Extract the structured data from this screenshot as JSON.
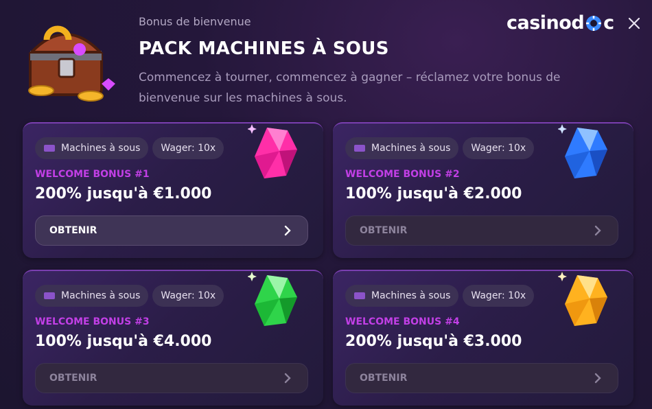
{
  "header": {
    "subtitle": "Bonus de bienvenue",
    "title": "PACK MACHINES À SOUS",
    "description": "Commencez à tourner, commencez à gagner – réclamez votre bonus de bienvenue sur les machines à sous.",
    "logo_left": "casinod",
    "logo_right": "c",
    "chest_icon": "treasure-chest-icon",
    "close_icon": "close-icon"
  },
  "cards": [
    {
      "tag_category": "Machines à sous",
      "tag_wager": "Wager: 10x",
      "bonus_label": "WELCOME BONUS #1",
      "amount": "200% jusqu'à €1.000",
      "button": "OBTENIR",
      "gem_color": "#ff2fa8",
      "state": "active"
    },
    {
      "tag_category": "Machines à sous",
      "tag_wager": "Wager: 10x",
      "bonus_label": "WELCOME BONUS #2",
      "amount": "100% jusqu'à €2.000",
      "button": "OBTENIR",
      "gem_color": "#2f7bff",
      "state": "disabled"
    },
    {
      "tag_category": "Machines à sous",
      "tag_wager": "Wager: 10x",
      "bonus_label": "WELCOME BONUS #3",
      "amount": "100% jusqu'à €4.000",
      "button": "OBTENIR",
      "gem_color": "#2fd44a",
      "state": "disabled"
    },
    {
      "tag_category": "Machines à sous",
      "tag_wager": "Wager: 10x",
      "bonus_label": "WELCOME BONUS #4",
      "amount": "200% jusqu'à €3.000",
      "button": "OBTENIR",
      "gem_color": "#ffb21f",
      "state": "disabled"
    }
  ],
  "colors": {
    "accent": "#c23fe6",
    "background": "#24173a",
    "card": "#2b1d48"
  }
}
